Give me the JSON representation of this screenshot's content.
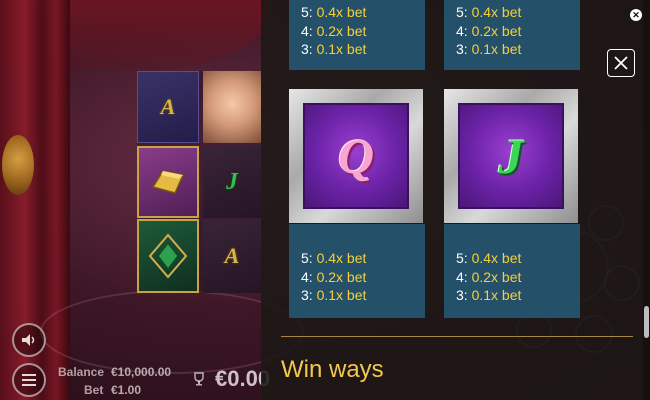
{
  "game": {
    "balance_label": "Balance",
    "balance_value": "€10,000.00",
    "bet_label": "Bet",
    "bet_value": "€1.00",
    "win_value": "€0.00",
    "reel_symbols": [
      "A",
      "J",
      "A"
    ]
  },
  "paytable": {
    "cards_top": [
      {
        "lines": [
          {
            "count": "5:",
            "mult": "0.4x bet"
          },
          {
            "count": "4:",
            "mult": "0.2x bet"
          },
          {
            "count": "3:",
            "mult": "0.1x bet"
          }
        ]
      },
      {
        "lines": [
          {
            "count": "5:",
            "mult": "0.4x bet"
          },
          {
            "count": "4:",
            "mult": "0.2x bet"
          },
          {
            "count": "3:",
            "mult": "0.1x bet"
          }
        ]
      }
    ],
    "cards": [
      {
        "symbol": "Q",
        "lines": [
          {
            "count": "5:",
            "mult": "0.4x bet"
          },
          {
            "count": "4:",
            "mult": "0.2x bet"
          },
          {
            "count": "3:",
            "mult": "0.1x bet"
          }
        ]
      },
      {
        "symbol": "J",
        "lines": [
          {
            "count": "5:",
            "mult": "0.4x bet"
          },
          {
            "count": "4:",
            "mult": "0.2x bet"
          },
          {
            "count": "3:",
            "mult": "0.1x bet"
          }
        ]
      }
    ],
    "section_title": "Win ways"
  },
  "colors": {
    "multiplier": "#f5d03a",
    "section_title": "#f2c94c",
    "card_background": "#24506a"
  },
  "icons": [
    "sound-icon",
    "menu-icon",
    "trophy-icon",
    "close-icon"
  ]
}
